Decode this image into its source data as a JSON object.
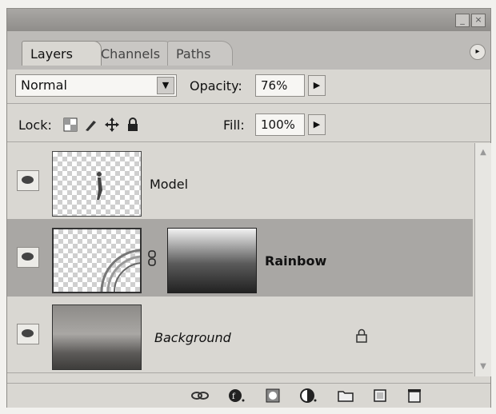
{
  "panel": {
    "tabs": [
      {
        "label": "Layers",
        "active": true
      },
      {
        "label": "Channels",
        "active": false
      },
      {
        "label": "Paths",
        "active": false
      }
    ],
    "blend_mode": "Normal",
    "opacity_label": "Opacity:",
    "opacity_value": "76%",
    "lock_label": "Lock:",
    "fill_label": "Fill:",
    "fill_value": "100%"
  },
  "layers": [
    {
      "name": "Model",
      "visible": true,
      "selected": false
    },
    {
      "name": "Rainbow",
      "visible": true,
      "selected": true,
      "has_mask": true
    },
    {
      "name": "Background",
      "visible": true,
      "selected": false,
      "locked": true
    }
  ],
  "icons": {
    "minimize": "minimize-icon",
    "close": "close-icon",
    "panel_menu": "panel-menu-icon"
  }
}
